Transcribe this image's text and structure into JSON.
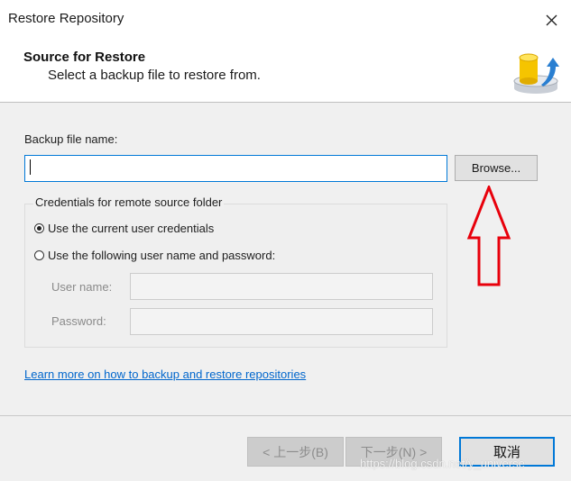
{
  "window": {
    "title": "Restore Repository",
    "close_icon": "close-icon"
  },
  "header": {
    "title": "Source for Restore",
    "subtitle": "Select a backup file to restore from.",
    "icon": "database-restore-icon"
  },
  "backup": {
    "label": "Backup file name:",
    "value": "",
    "browse_label": "Browse..."
  },
  "credentials": {
    "legend": "Credentials for remote source folder",
    "options": [
      {
        "label": "Use the current user credentials",
        "selected": true
      },
      {
        "label": "Use the following user name and password:",
        "selected": false
      }
    ],
    "username_label": "User name:",
    "username_value": "",
    "password_label": "Password:",
    "password_value": ""
  },
  "links": {
    "learn_more": "Learn more on how to backup and restore repositories"
  },
  "footer": {
    "back_label": "< 上一步(B)",
    "next_label": "下一步(N) >",
    "cancel_label": "取消"
  },
  "annotation": {
    "arrow_color": "#e8000b",
    "arrow_icon": "up-arrow-annotation-icon"
  },
  "watermark": "https://blog.csdn.net/y_universe",
  "colors": {
    "accent": "#0078d7",
    "link": "#0066cc"
  }
}
